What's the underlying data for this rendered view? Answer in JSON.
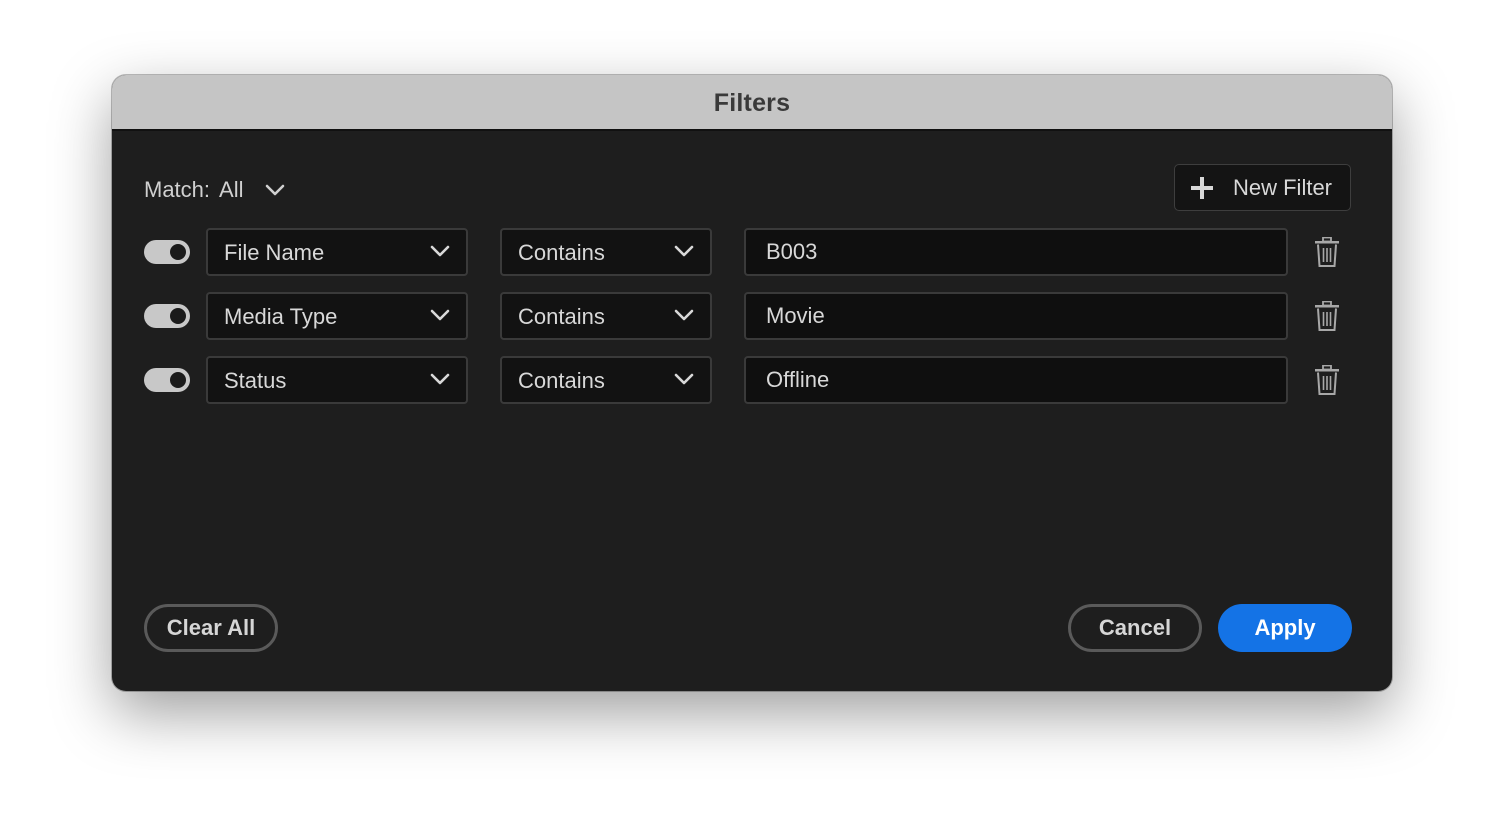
{
  "dialog": {
    "title": "Filters"
  },
  "match": {
    "label": "Match:",
    "value": "All"
  },
  "new_filter_label": "New Filter",
  "filters": [
    {
      "enabled": true,
      "field": "File Name",
      "operator": "Contains",
      "value": "B003"
    },
    {
      "enabled": true,
      "field": "Media Type",
      "operator": "Contains",
      "value": "Movie"
    },
    {
      "enabled": true,
      "field": "Status",
      "operator": "Contains",
      "value": "Offline"
    }
  ],
  "footer": {
    "clear_all_label": "Clear All",
    "cancel_label": "Cancel",
    "apply_label": "Apply"
  },
  "colors": {
    "accent": "#1473e6",
    "panel_bg": "#1e1e1e",
    "titlebar_bg": "#c5c5c5"
  },
  "icons": {
    "dropdown": "chevron-down-icon",
    "add": "plus-icon",
    "delete": "trash-icon"
  }
}
